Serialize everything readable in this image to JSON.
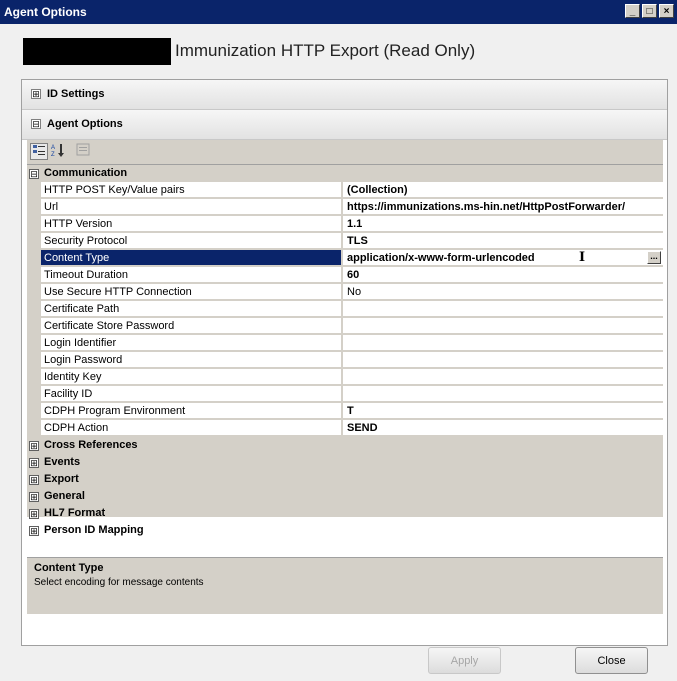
{
  "window": {
    "title": "Agent Options",
    "controls": [
      "_",
      "□",
      "×"
    ]
  },
  "header": {
    "title": "Immunization HTTP Export (Read Only)"
  },
  "sections": {
    "id_settings": {
      "expander": "⊞",
      "label": "ID Settings"
    },
    "agent_options": {
      "expander": "⊟",
      "label": "Agent Options"
    }
  },
  "toolbar": {
    "categorized_icon": "categorized-icon",
    "alphabetical_icon": "alphabetical-icon",
    "property_pages_icon": "property-pages-icon"
  },
  "grid": {
    "communication": {
      "expander": "⊟",
      "label": "Communication"
    },
    "properties": [
      {
        "name": "HTTP POST Key/Value pairs",
        "value": "(Collection)",
        "bold": true
      },
      {
        "name": "Url",
        "value": "https://immunizations.ms-hin.net/HttpPostForwarder/",
        "bold": true
      },
      {
        "name": "HTTP Version",
        "value": "1.1",
        "bold": true
      },
      {
        "name": "Security Protocol",
        "value": "TLS",
        "bold": true
      },
      {
        "name": "Content Type",
        "value": "application/x-www-form-urlencoded",
        "bold": true,
        "selected": true,
        "button": "..."
      },
      {
        "name": "Timeout Duration",
        "value": "60",
        "bold": true
      },
      {
        "name": "Use Secure HTTP Connection",
        "value": "No",
        "bold": false
      },
      {
        "name": "Certificate Path",
        "value": "",
        "bold": false
      },
      {
        "name": "Certificate Store Password",
        "value": "",
        "bold": false
      },
      {
        "name": "Login Identifier",
        "value": "",
        "bold": false
      },
      {
        "name": "Login Password",
        "value": "",
        "bold": false
      },
      {
        "name": "Identity Key",
        "value": "",
        "bold": false
      },
      {
        "name": "Facility ID",
        "value": "",
        "bold": false
      },
      {
        "name": "CDPH Program Environment",
        "value": "T",
        "bold": true
      },
      {
        "name": "CDPH Action",
        "value": "SEND",
        "bold": true
      }
    ],
    "categories": [
      {
        "expander": "⊞",
        "label": "Cross References"
      },
      {
        "expander": "⊞",
        "label": "Events"
      },
      {
        "expander": "⊞",
        "label": "Export"
      },
      {
        "expander": "⊞",
        "label": "General"
      },
      {
        "expander": "⊞",
        "label": "HL7 Format"
      },
      {
        "expander": "⊞",
        "label": "Person ID Mapping"
      }
    ]
  },
  "description": {
    "title": "Content Type",
    "text": "Select encoding for message contents"
  },
  "buttons": {
    "apply": "Apply",
    "close": "Close"
  }
}
